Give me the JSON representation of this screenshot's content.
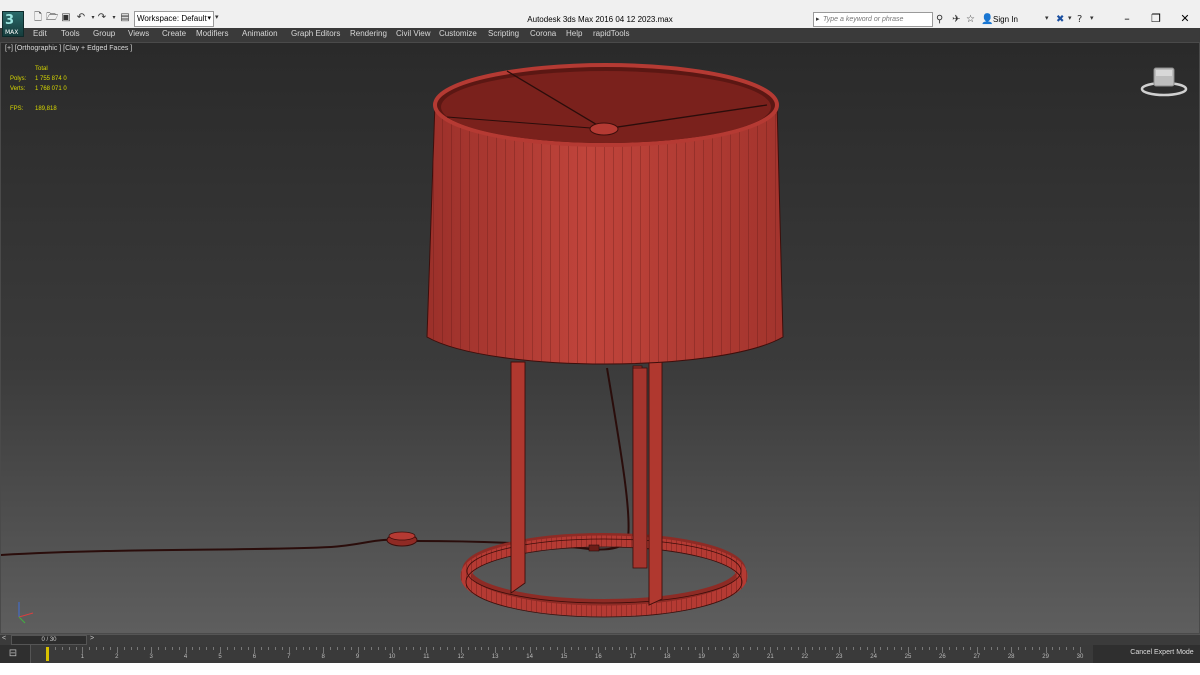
{
  "app": {
    "logo_text": "MAX",
    "window_title": "Autodesk 3ds Max 2016    04 12 2023.max",
    "workspace_label": "Workspace: Default",
    "search_placeholder": "Type a keyword or phrase",
    "signin_label": "Sign In"
  },
  "menu": [
    "Edit",
    "Tools",
    "Group",
    "Views",
    "Create",
    "Modifiers",
    "Animation",
    "Graph Editors",
    "Rendering",
    "Civil View",
    "Customize",
    "Scripting",
    "Corona",
    "Help",
    "rapidTools"
  ],
  "viewport": {
    "label": "[+] [Orthographic ] [Clay + Edged Faces ]",
    "stats": {
      "header": "Total",
      "polys_label": "Polys:",
      "polys_value": "1 755 874  0",
      "verts_label": "Verts:",
      "verts_value": "1 768 071  0",
      "fps_label": "FPS:",
      "fps_value": "189,818"
    },
    "model_color": "#b53a33",
    "wire_color": "#5a1512"
  },
  "timeline": {
    "slider_text": "0 / 30",
    "prev_symbol": "<",
    "next_symbol": ">",
    "frames": [
      "1",
      "2",
      "3",
      "4",
      "5",
      "6",
      "7",
      "8",
      "9",
      "10",
      "11",
      "12",
      "13",
      "14",
      "15",
      "16",
      "17",
      "18",
      "19",
      "20",
      "21",
      "22",
      "23",
      "24",
      "25",
      "26",
      "27",
      "28",
      "29",
      "30"
    ],
    "current_frame": 0,
    "key_color": "#d9c100"
  },
  "status": {
    "cancel_expert_label": "Cancel Expert Mode"
  },
  "icons": [
    "new-file-icon",
    "open-file-icon",
    "save-icon",
    "undo-icon",
    "redo-icon",
    "project-folder-icon",
    "binoculars-icon",
    "communication-center-icon",
    "favorites-icon",
    "user-icon",
    "exchange-icon",
    "help-icon",
    "minimize-icon",
    "restore-icon",
    "close-icon",
    "viewcube-icon",
    "axis-tripod-icon",
    "trackbar-toggle-icon"
  ]
}
